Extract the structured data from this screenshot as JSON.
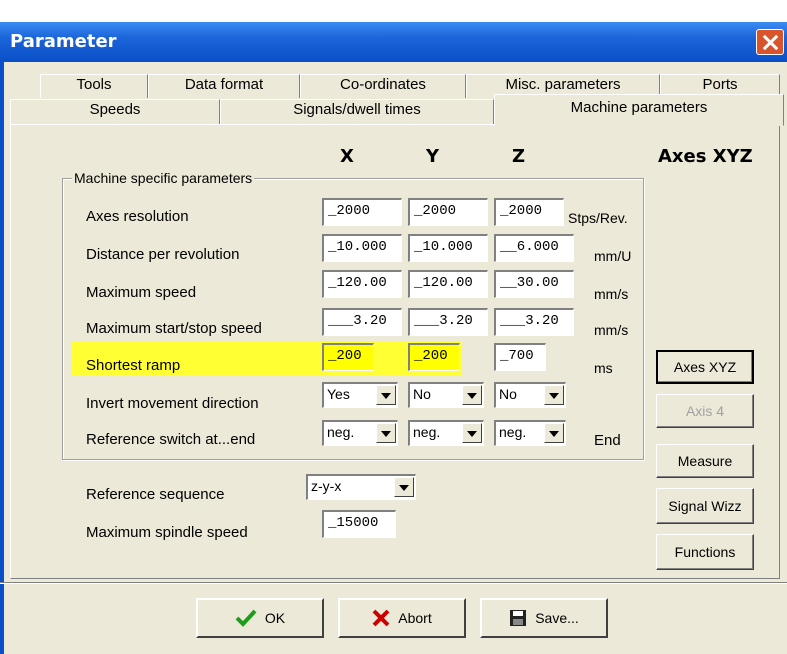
{
  "window": {
    "title": "Parameter"
  },
  "tabs_row1": [
    "Tools",
    "Data format",
    "Co-ordinates",
    "Misc. parameters",
    "Ports"
  ],
  "tabs_row2": [
    "Speeds",
    "Signals/dwell times",
    "Machine parameters"
  ],
  "headers": {
    "x": "X",
    "y": "Y",
    "z": "Z",
    "axes": "Axes XYZ"
  },
  "group_label": "Machine specific parameters",
  "rows": [
    {
      "label": "Axes resolution",
      "x": "_2000",
      "y": "_2000",
      "z": "_2000",
      "unit": "Stps/Rev."
    },
    {
      "label": "Distance per revolution",
      "x": "_10.000",
      "y": "_10.000",
      "z": "__6.000",
      "unit": "mm/U"
    },
    {
      "label": "Maximum speed",
      "x": "_120.00",
      "y": "_120.00",
      "z": "__30.00",
      "unit": "mm/s"
    },
    {
      "label": "Maximum start/stop speed",
      "x": "___3.20",
      "y": "___3.20",
      "z": "___3.20",
      "unit": "mm/s"
    },
    {
      "label": "Shortest ramp",
      "x": "_200",
      "y": "_200",
      "z": "_700",
      "unit": "ms"
    }
  ],
  "invert": {
    "label": "Invert movement direction",
    "x": "Yes",
    "y": "No",
    "z": "No"
  },
  "refswitch": {
    "label": "Reference switch at...end",
    "x": "neg.",
    "y": "neg.",
    "z": "neg.",
    "unit": "End"
  },
  "ref_sequence": {
    "label": "Reference sequence",
    "value": "z-y-x"
  },
  "spindle": {
    "label": "Maximum spindle speed",
    "value": "_15000"
  },
  "side_buttons": [
    "Axes XYZ",
    "Axis 4",
    "Measure",
    "Signal Wizz",
    "Functions"
  ],
  "bottom_buttons": {
    "ok": "OK",
    "abort": "Abort",
    "save": "Save..."
  },
  "colors": {
    "highlight": "#ffff00",
    "title_bar": "#0a4fc8",
    "face": "#ece9d8"
  }
}
